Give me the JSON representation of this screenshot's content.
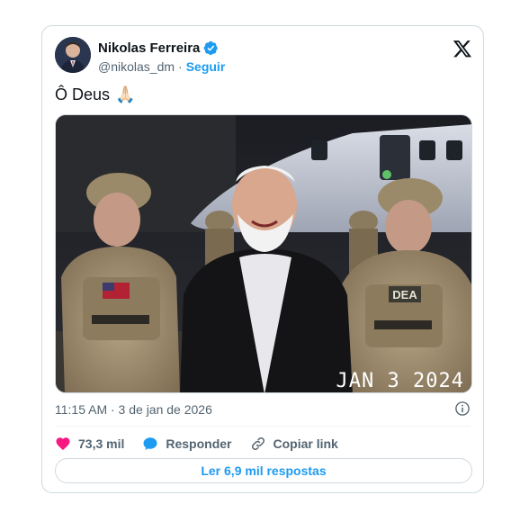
{
  "author": {
    "name": "Nikolas Ferreira",
    "handle": "@nikolas_dm",
    "separator": "·",
    "follow_label": "Seguir"
  },
  "tweet": {
    "text": "Ô Deus",
    "emoji": "🙏🏻"
  },
  "media": {
    "date_stamp": "JAN  3 2024",
    "patch_label": "DEA"
  },
  "meta": {
    "timestamp": "11:15 AM · 3 de jan de 2026"
  },
  "actions": {
    "likes": "73,3 mil",
    "reply_label": "Responder",
    "copy_label": "Copiar link"
  },
  "replies_button": "Ler 6,9 mil respostas",
  "colors": {
    "accent": "#1d9bf0",
    "like": "#f91880",
    "muted": "#536471"
  },
  "icons": [
    "verified-badge-icon",
    "x-logo-icon",
    "info-icon",
    "heart-icon",
    "reply-bubble-icon",
    "link-icon"
  ]
}
